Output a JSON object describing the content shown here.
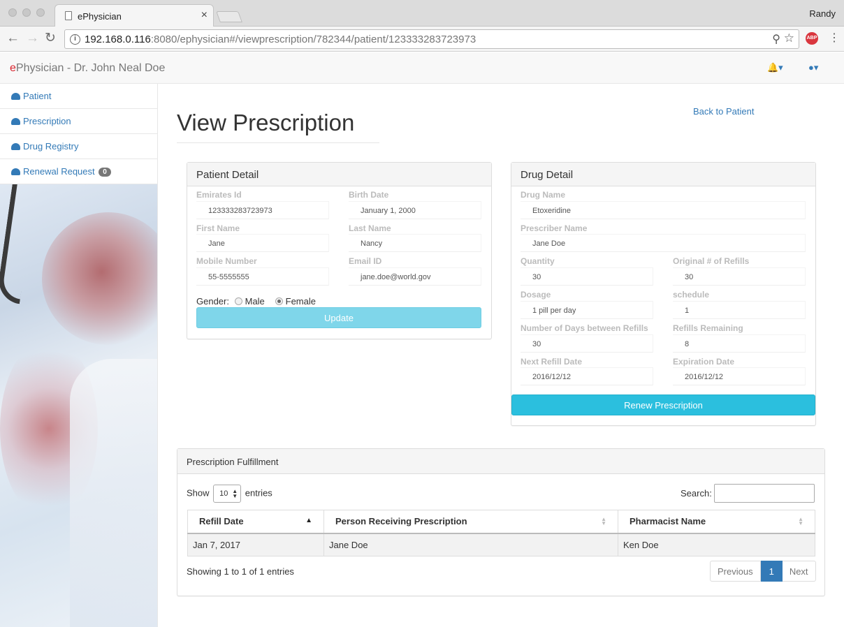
{
  "browser": {
    "tab_title": "ePhysician",
    "tab_close": "×",
    "user": "Randy",
    "url_host": "192.168.0.116",
    "url_rest": ":8080/ephysician#/viewprescription/782344/patient/123333283723973",
    "abp": "ABP"
  },
  "app": {
    "brand_e": "e",
    "brand_rest": "Physician - Dr. John Neal Doe"
  },
  "sidebar": {
    "items": [
      {
        "label": "Patient"
      },
      {
        "label": "Prescription"
      },
      {
        "label": "Drug Registry"
      },
      {
        "label": "Renewal Request",
        "badge": "0"
      }
    ]
  },
  "page": {
    "title": "View Prescription",
    "back_link": "Back to Patient"
  },
  "patient": {
    "heading": "Patient Detail",
    "emirates_label": "Emirates Id",
    "emirates_value": "123333283723973",
    "birth_label": "Birth Date",
    "birth_value": "January 1, 2000",
    "first_label": "First Name",
    "first_value": "Jane",
    "last_label": "Last Name",
    "last_value": "Nancy",
    "mobile_label": "Mobile Number",
    "mobile_value": "55-5555555",
    "email_label": "Email ID",
    "email_value": "jane.doe@world.gov",
    "gender_label": "Gender:",
    "male_label": "Male",
    "female_label": "Female",
    "selected_gender": "Female",
    "update_button": "Update"
  },
  "drug": {
    "heading": "Drug Detail",
    "name_label": "Drug Name",
    "name_value": "Etoxeridine",
    "prescriber_label": "Prescriber Name",
    "prescriber_value": "Jane Doe",
    "quantity_label": "Quantity",
    "quantity_value": "30",
    "orig_refills_label": "Original # of Refills",
    "orig_refills_value": "30",
    "dosage_label": "Dosage",
    "dosage_value": "1 pill per day",
    "schedule_label": "schedule",
    "schedule_value": "1",
    "days_label": "Number of Days between Refills",
    "days_value": "30",
    "remaining_label": "Refills Remaining",
    "remaining_value": "8",
    "next_label": "Next Refill Date",
    "next_value": "2016/12/12",
    "expiration_label": "Expiration Date",
    "expiration_value": "2016/12/12",
    "renew_button": "Renew Prescription"
  },
  "fulfillment": {
    "heading": "Prescription Fulfillment",
    "show_label": "Show",
    "entries_value": "10",
    "entries_label": "entries",
    "search_label": "Search:",
    "columns": [
      "Refill Date",
      "Person Receiving Prescription",
      "Pharmacist Name"
    ],
    "rows": [
      [
        "Jan 7, 2017",
        "Jane Doe",
        "Ken Doe"
      ]
    ],
    "info": "Showing 1 to 1 of 1 entries",
    "prev": "Previous",
    "page": "1",
    "next": "Next"
  }
}
